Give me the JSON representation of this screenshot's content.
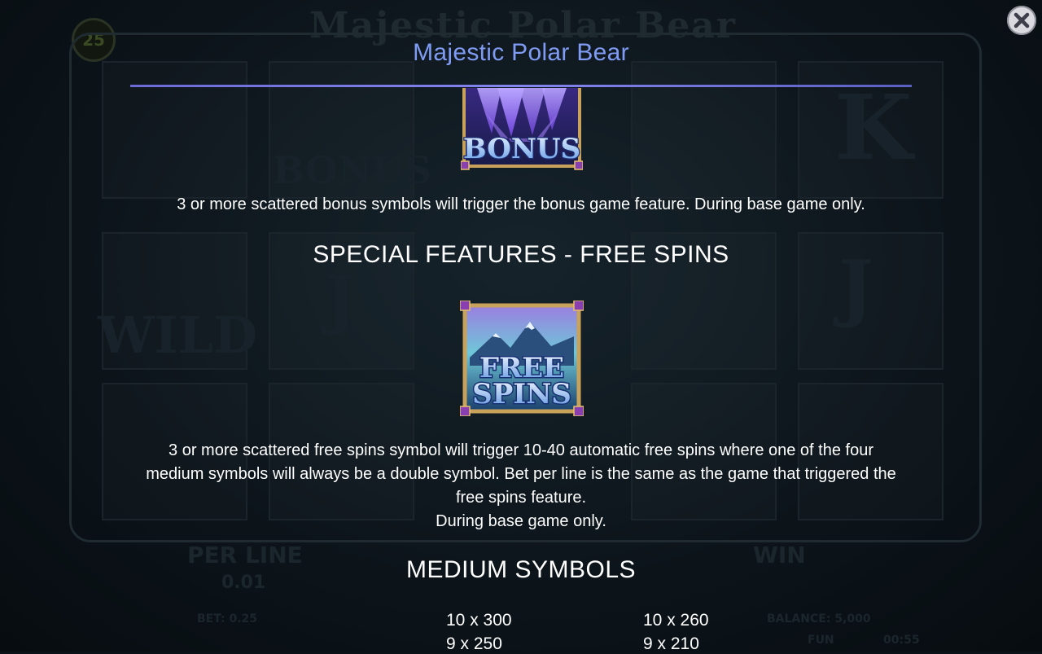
{
  "background": {
    "game_title": "Majestic Polar Bear",
    "coin_value": "25",
    "bonus_ghost": "BONUS",
    "wild_ghost": "WILD",
    "k_ghost": "K",
    "j_ghost": "J",
    "per_line_label": "PER LINE",
    "per_line_value": "0.01",
    "win_label": "WIN",
    "bet_text": "BET: 0.25",
    "balance_text": "BALANCE: 5,000",
    "fun_text": "FUN",
    "time_text": "00:55"
  },
  "overlay": {
    "title": "Majestic Polar Bear",
    "bonus_symbol_text": "BONUS",
    "bonus_description": "3 or more scattered bonus symbols will trigger the bonus game feature. During base game only.",
    "free_spins_heading": "SPECIAL FEATURES - FREE SPINS",
    "free_spins_symbol_line1": "FREE",
    "free_spins_symbol_line2": "SPINS",
    "free_spins_description": [
      "3 or more scattered free spins symbol will trigger 10-40 automatic free spins where one of the four",
      "medium symbols will always be a double symbol. Bet per line is the same as the game that triggered the",
      "free spins feature.",
      "During base game only."
    ],
    "medium_heading": "MEDIUM SYMBOLS",
    "medium_paytable": [
      [
        "10 x 300",
        "10 x 260"
      ],
      [
        "9 x 250",
        "9 x 210"
      ]
    ]
  },
  "colors": {
    "title": "#7f9bf3",
    "divider": "#7b7be8",
    "text": "#ffffff",
    "background": "#0b1218"
  },
  "icons": {
    "close": "close-x-icon"
  }
}
